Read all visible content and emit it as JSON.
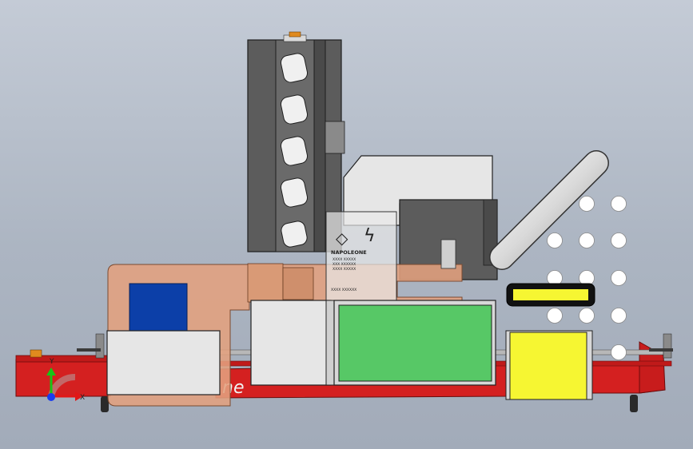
{
  "viewport": {
    "background_top": "#c4cbd6",
    "background_bottom": "#a2abb9"
  },
  "model": {
    "colors": {
      "frame_red": "#d42020",
      "copper_plate": "#e3a07e",
      "dark_gray": "#5c5c5c",
      "light_gray": "#e6e6e6",
      "green_panel": "#57c866",
      "yellow_block": "#f6f632",
      "blue_block": "#0c3fa8",
      "orange_cap": "#e08a1e"
    },
    "plate_label": {
      "brand": "NAPOLEONE",
      "line1": "XXXX XXXXX",
      "line2": "XXX XXXXXX",
      "line3": "XXXX XXXXX",
      "note": "XXXX XXXXXX"
    },
    "frame_text": "ne"
  },
  "triad": {
    "y_label": "Y",
    "x_label": "X",
    "y_color": "#16c516",
    "x_color": "#e01818",
    "z_color": "#1a3cf0"
  }
}
